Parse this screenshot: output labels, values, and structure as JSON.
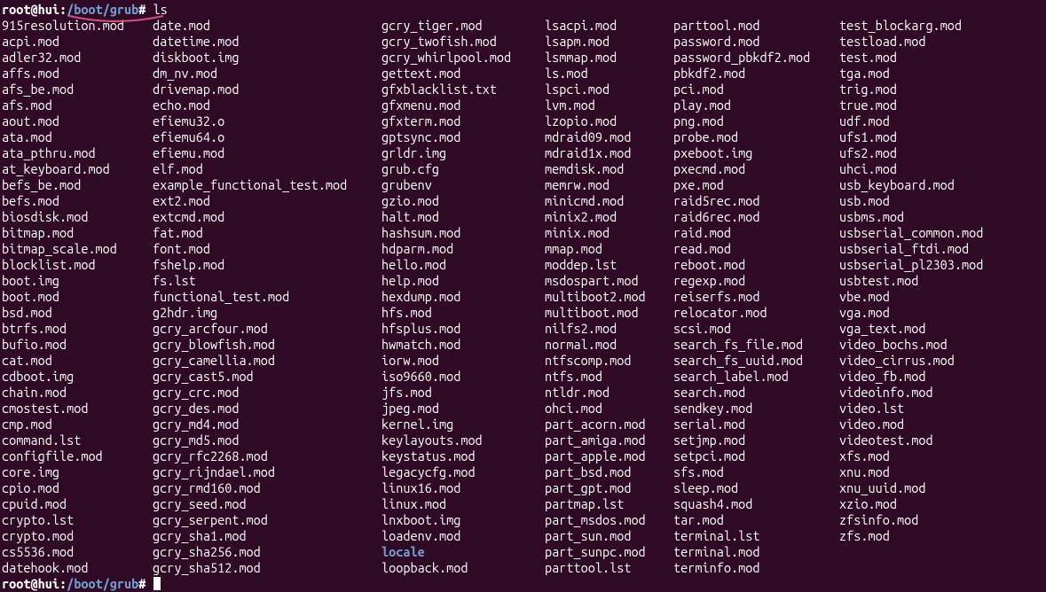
{
  "prompt": {
    "user_host": "root@hui",
    "colon": ":",
    "path": "/boot/grub",
    "hash": "#",
    "command": "ls"
  },
  "columns": [
    [
      "915resolution.mod",
      "acpi.mod",
      "adler32.mod",
      "affs.mod",
      "afs_be.mod",
      "afs.mod",
      "aout.mod",
      "ata.mod",
      "ata_pthru.mod",
      "at_keyboard.mod",
      "befs_be.mod",
      "befs.mod",
      "biosdisk.mod",
      "bitmap.mod",
      "bitmap_scale.mod",
      "blocklist.mod",
      "boot.img",
      "boot.mod",
      "bsd.mod",
      "btrfs.mod",
      "bufio.mod",
      "cat.mod",
      "cdboot.img",
      "chain.mod",
      "cmostest.mod",
      "cmp.mod",
      "command.lst",
      "configfile.mod",
      "core.img",
      "cpio.mod",
      "cpuid.mod",
      "crypto.lst",
      "crypto.mod",
      "cs5536.mod",
      "datehook.mod"
    ],
    [
      "date.mod",
      "datetime.mod",
      "diskboot.img",
      "dm_nv.mod",
      "drivemap.mod",
      "echo.mod",
      "efiemu32.o",
      "efiemu64.o",
      "efiemu.mod",
      "elf.mod",
      "example_functional_test.mod",
      "ext2.mod",
      "extcmd.mod",
      "fat.mod",
      "font.mod",
      "fshelp.mod",
      "fs.lst",
      "functional_test.mod",
      "g2hdr.img",
      "gcry_arcfour.mod",
      "gcry_blowfish.mod",
      "gcry_camellia.mod",
      "gcry_cast5.mod",
      "gcry_crc.mod",
      "gcry_des.mod",
      "gcry_md4.mod",
      "gcry_md5.mod",
      "gcry_rfc2268.mod",
      "gcry_rijndael.mod",
      "gcry_rmd160.mod",
      "gcry_seed.mod",
      "gcry_serpent.mod",
      "gcry_sha1.mod",
      "gcry_sha256.mod",
      "gcry_sha512.mod"
    ],
    [
      "gcry_tiger.mod",
      "gcry_twofish.mod",
      "gcry_whirlpool.mod",
      "gettext.mod",
      "gfxblacklist.txt",
      "gfxmenu.mod",
      "gfxterm.mod",
      "gptsync.mod",
      "grldr.img",
      "grub.cfg",
      "grubenv",
      "gzio.mod",
      "halt.mod",
      "hashsum.mod",
      "hdparm.mod",
      "hello.mod",
      "help.mod",
      "hexdump.mod",
      "hfs.mod",
      "hfsplus.mod",
      "hwmatch.mod",
      "iorw.mod",
      "iso9660.mod",
      "jfs.mod",
      "jpeg.mod",
      "kernel.img",
      "keylayouts.mod",
      "keystatus.mod",
      "legacycfg.mod",
      "linux16.mod",
      "linux.mod",
      "lnxboot.img",
      "loadenv.mod",
      {
        "name": "locale",
        "dir": true
      },
      "loopback.mod"
    ],
    [
      "lsacpi.mod",
      "lsapm.mod",
      "lsmmap.mod",
      "ls.mod",
      "lspci.mod",
      "lvm.mod",
      "lzopio.mod",
      "mdraid09.mod",
      "mdraid1x.mod",
      "memdisk.mod",
      "memrw.mod",
      "minicmd.mod",
      "minix2.mod",
      "minix.mod",
      "mmap.mod",
      "moddep.lst",
      "msdospart.mod",
      "multiboot2.mod",
      "multiboot.mod",
      "nilfs2.mod",
      "normal.mod",
      "ntfscomp.mod",
      "ntfs.mod",
      "ntldr.mod",
      "ohci.mod",
      "part_acorn.mod",
      "part_amiga.mod",
      "part_apple.mod",
      "part_bsd.mod",
      "part_gpt.mod",
      "partmap.lst",
      "part_msdos.mod",
      "part_sun.mod",
      "part_sunpc.mod",
      "parttool.lst"
    ],
    [
      "parttool.mod",
      "password.mod",
      "password_pbkdf2.mod",
      "pbkdf2.mod",
      "pci.mod",
      "play.mod",
      "png.mod",
      "probe.mod",
      "pxeboot.img",
      "pxecmd.mod",
      "pxe.mod",
      "raid5rec.mod",
      "raid6rec.mod",
      "raid.mod",
      "read.mod",
      "reboot.mod",
      "regexp.mod",
      "reiserfs.mod",
      "relocator.mod",
      "scsi.mod",
      "search_fs_file.mod",
      "search_fs_uuid.mod",
      "search_label.mod",
      "search.mod",
      "sendkey.mod",
      "serial.mod",
      "setjmp.mod",
      "setpci.mod",
      "sfs.mod",
      "sleep.mod",
      "squash4.mod",
      "tar.mod",
      "terminal.lst",
      "terminal.mod",
      "terminfo.mod"
    ],
    [
      "test_blockarg.mod",
      "testload.mod",
      "test.mod",
      "tga.mod",
      "trig.mod",
      "true.mod",
      "udf.mod",
      "ufs1.mod",
      "ufs2.mod",
      "uhci.mod",
      "usb_keyboard.mod",
      "usb.mod",
      "usbms.mod",
      "usbserial_common.mod",
      "usbserial_ftdi.mod",
      "usbserial_pl2303.mod",
      "usbtest.mod",
      "vbe.mod",
      "vga.mod",
      "vga_text.mod",
      "video_bochs.mod",
      "video_cirrus.mod",
      "video_fb.mod",
      "videoinfo.mod",
      "video.lst",
      "video.mod",
      "videotest.mod",
      "xfs.mod",
      "xnu.mod",
      "xnu_uuid.mod",
      "xzio.mod",
      "zfsinfo.mod",
      "zfs.mod"
    ]
  ]
}
